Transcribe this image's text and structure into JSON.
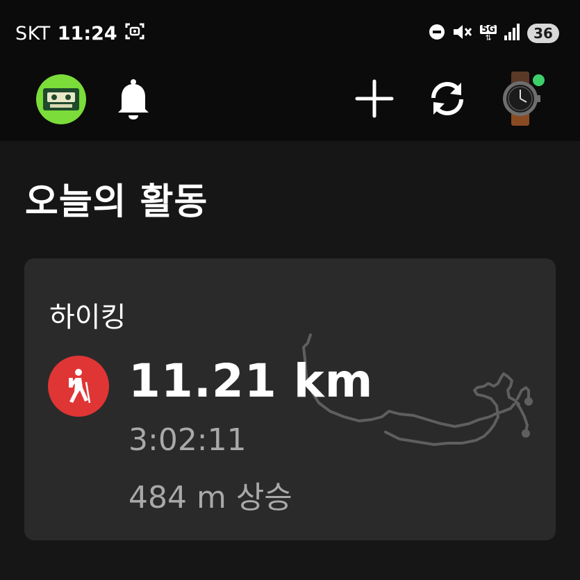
{
  "status_bar": {
    "carrier": "SKT",
    "time": "11:24",
    "network": "5G",
    "battery": "36",
    "icons": [
      "screen-record-icon",
      "do-not-disturb-icon",
      "mute-icon",
      "5g-icon",
      "signal-icon",
      "battery-icon"
    ]
  },
  "top_bar": {
    "icons": [
      "avatar-icon",
      "bell-icon",
      "plus-icon",
      "sync-icon",
      "watch-icon"
    ],
    "device_status_color": "#3ccf6a"
  },
  "page": {
    "title": "오늘의 활동"
  },
  "activity": {
    "type": "하이킹",
    "distance": "11.21 km",
    "duration": "3:02:11",
    "elevation": "484 m 상승",
    "icon": "hiking-icon",
    "icon_bg_color": "#e03535"
  },
  "colors": {
    "background": "#161616",
    "bars": "#0b0b0b",
    "card": "#2a2a2a",
    "secondary_text": "#a9a9a9"
  }
}
